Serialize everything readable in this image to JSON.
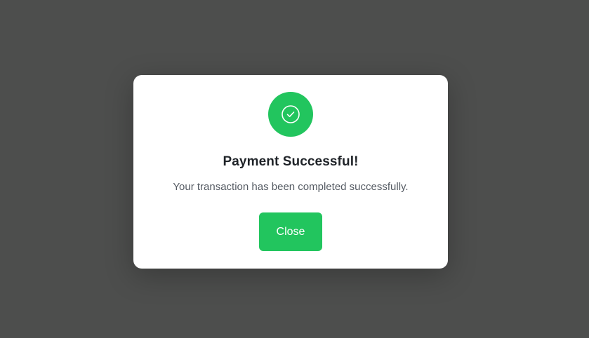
{
  "colors": {
    "backdrop": "#4d4e4d",
    "accent": "#22c55e",
    "title": "#1f2328",
    "message": "#555b63"
  },
  "modal": {
    "icon": "check-circle-icon",
    "title": "Payment Successful!",
    "message": "Your transaction has been completed successfully.",
    "close_label": "Close"
  }
}
